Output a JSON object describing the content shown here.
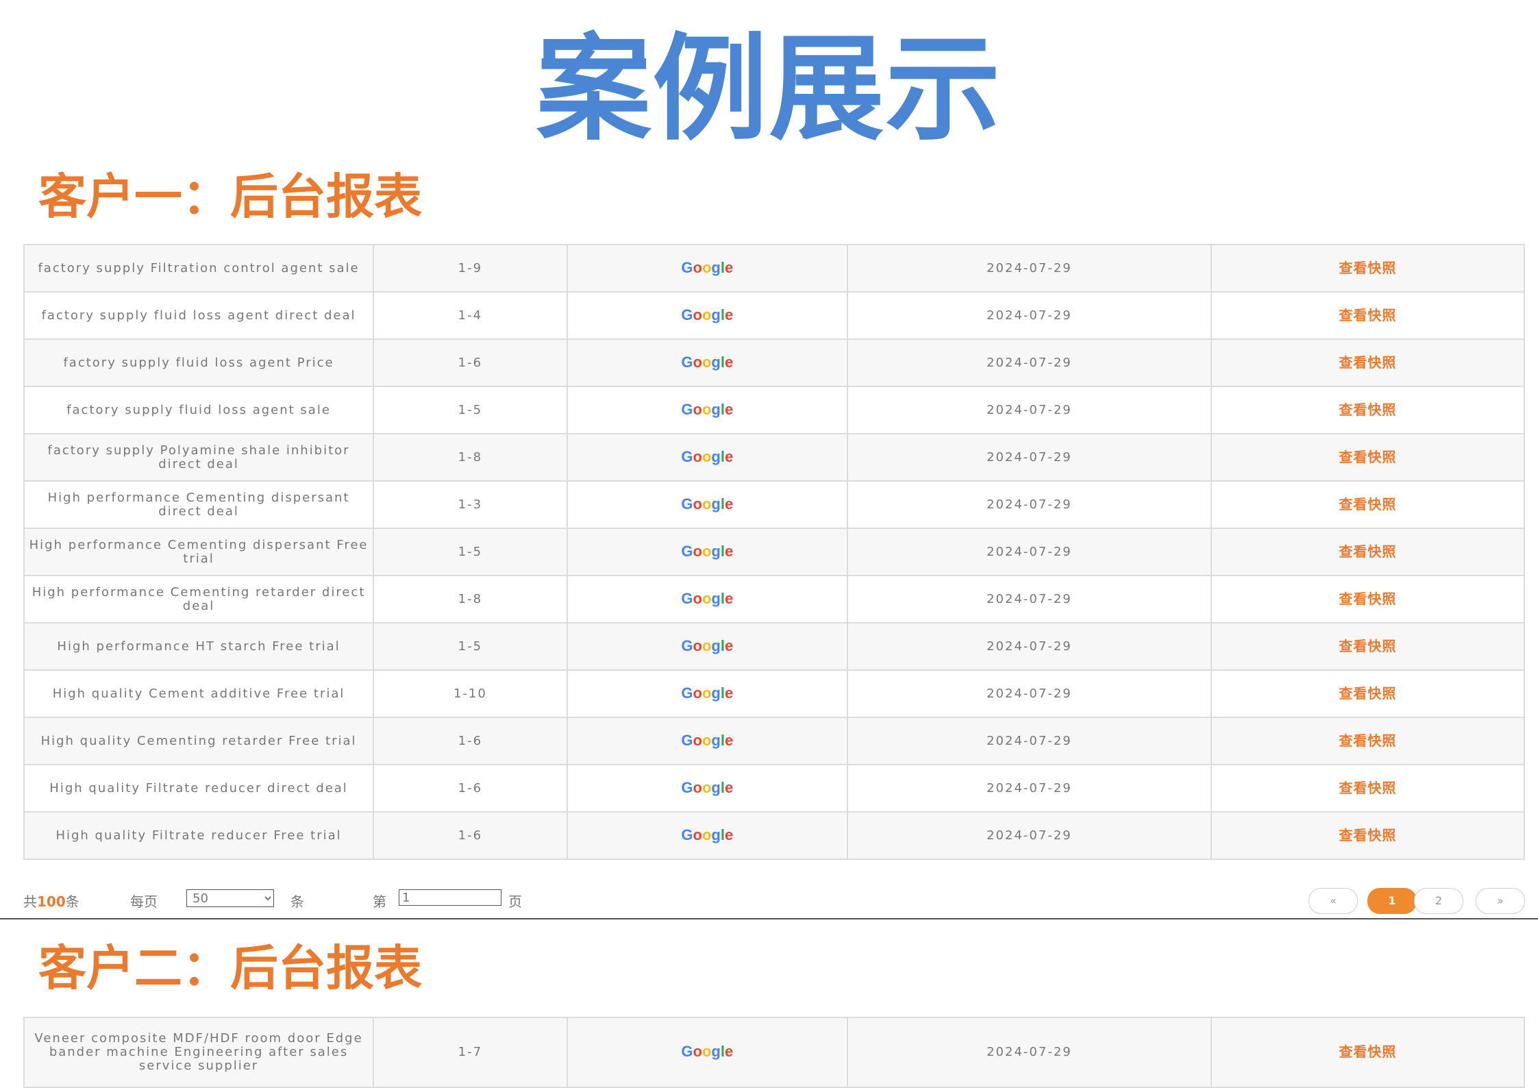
{
  "title": "案例展示",
  "section1": {
    "heading": "客户一：后台报表"
  },
  "section2": {
    "heading": "客户二：后台报表"
  },
  "engine_logo": "Google",
  "table1": {
    "rows": [
      {
        "keyword": "factory supply Filtration control agent sale",
        "rank": "1-9",
        "date": "2024-07-29",
        "snapshot": "查看快照"
      },
      {
        "keyword": "factory supply fluid loss agent direct deal",
        "rank": "1-4",
        "date": "2024-07-29",
        "snapshot": "查看快照"
      },
      {
        "keyword": "factory supply fluid loss agent Price",
        "rank": "1-6",
        "date": "2024-07-29",
        "snapshot": "查看快照"
      },
      {
        "keyword": "factory supply fluid loss agent sale",
        "rank": "1-5",
        "date": "2024-07-29",
        "snapshot": "查看快照"
      },
      {
        "keyword": "factory supply Polyamine shale inhibitor direct deal",
        "rank": "1-8",
        "date": "2024-07-29",
        "snapshot": "查看快照"
      },
      {
        "keyword": "High performance Cementing dispersant direct deal",
        "rank": "1-3",
        "date": "2024-07-29",
        "snapshot": "查看快照"
      },
      {
        "keyword": "High performance Cementing dispersant Free trial",
        "rank": "1-5",
        "date": "2024-07-29",
        "snapshot": "查看快照"
      },
      {
        "keyword": "High performance Cementing retarder direct deal",
        "rank": "1-8",
        "date": "2024-07-29",
        "snapshot": "查看快照"
      },
      {
        "keyword": "High performance HT starch Free trial",
        "rank": "1-5",
        "date": "2024-07-29",
        "snapshot": "查看快照"
      },
      {
        "keyword": "High quality Cement additive Free trial",
        "rank": "1-10",
        "date": "2024-07-29",
        "snapshot": "查看快照"
      },
      {
        "keyword": "High quality Cementing retarder Free trial",
        "rank": "1-6",
        "date": "2024-07-29",
        "snapshot": "查看快照"
      },
      {
        "keyword": "High quality Filtrate reducer direct deal",
        "rank": "1-6",
        "date": "2024-07-29",
        "snapshot": "查看快照"
      },
      {
        "keyword": "High quality Filtrate reducer Free trial",
        "rank": "1-6",
        "date": "2024-07-29",
        "snapshot": "查看快照"
      }
    ]
  },
  "pager": {
    "total_prefix": "共",
    "total_count": "100",
    "total_suffix": "条",
    "per_page_label": "每页",
    "per_page_value": "50",
    "per_page_suffix": "条",
    "goto_prefix": "第",
    "goto_value": "1",
    "goto_suffix": "页",
    "first": "«",
    "current_page": "1",
    "next_page": "2",
    "last": "»"
  },
  "table2": {
    "rows": [
      {
        "keyword": "Veneer composite MDF/HDF room door Edge bander machine Engineering after sales service supplier",
        "rank": "1-7",
        "date": "2024-07-29",
        "snapshot": "查看快照"
      }
    ]
  }
}
